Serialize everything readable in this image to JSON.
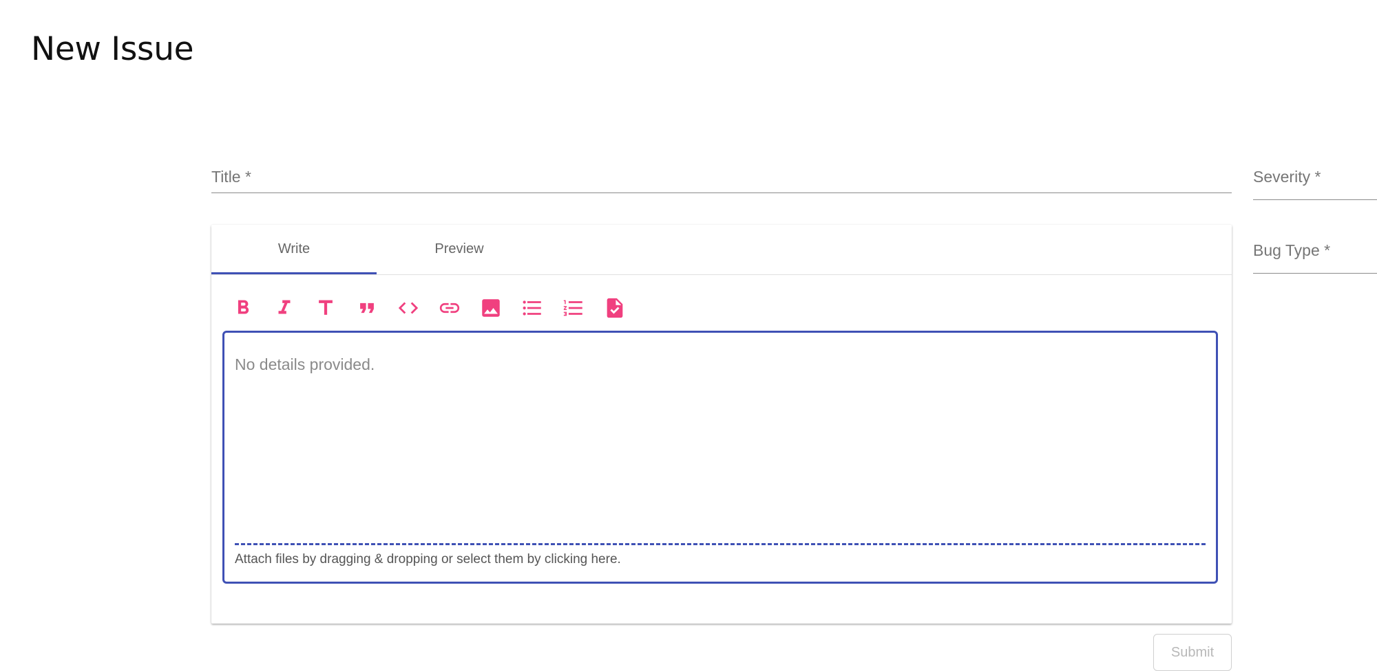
{
  "page": {
    "title": "New Issue"
  },
  "form": {
    "title_label": "Title *",
    "severity_label": "Severity *",
    "bug_type_label": "Bug Type *"
  },
  "editor": {
    "tabs": [
      {
        "label": "Write",
        "active": true
      },
      {
        "label": "Preview",
        "active": false
      }
    ],
    "toolbar": [
      {
        "icon": "bold-icon",
        "label": "Bold"
      },
      {
        "icon": "italic-icon",
        "label": "Italic"
      },
      {
        "icon": "header-icon",
        "label": "Header"
      },
      {
        "icon": "quote-icon",
        "label": "Quote"
      },
      {
        "icon": "code-icon",
        "label": "Code"
      },
      {
        "icon": "link-icon",
        "label": "Link"
      },
      {
        "icon": "image-icon",
        "label": "Image"
      },
      {
        "icon": "unordered-list-icon",
        "label": "Unordered list"
      },
      {
        "icon": "ordered-list-icon",
        "label": "Ordered list"
      },
      {
        "icon": "checked-file-icon",
        "label": "Task list"
      }
    ],
    "placeholder": "No details provided.",
    "attach_text": "Attach files by dragging & dropping or select them by clicking here."
  },
  "actions": {
    "submit_label": "Submit",
    "submit_disabled": true
  },
  "colors": {
    "accent": "#3f51b5",
    "icon_pink": "#f0407f",
    "label_gray": "#767676"
  }
}
